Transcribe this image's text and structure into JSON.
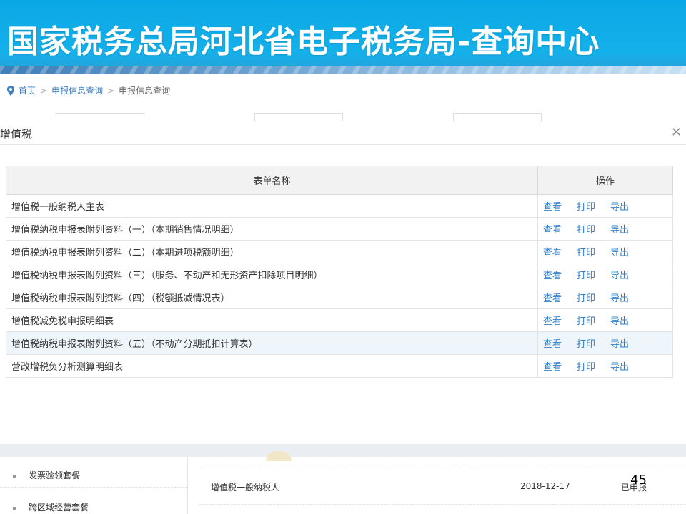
{
  "banner": {
    "title": "国家税务总局河北省电子税务局-查询中心"
  },
  "breadcrumb": {
    "home": "首页",
    "sep1": ">",
    "level1": "申报信息查询",
    "sep2": ">",
    "current": "申报信息查询"
  },
  "modal": {
    "title": "增值税",
    "close": "×",
    "table": {
      "col_name": "表单名称",
      "col_ops": "操作",
      "rows": [
        {
          "name": "增值税一般纳税人主表",
          "view": "查看",
          "print": "打印",
          "export": "导出"
        },
        {
          "name": "增值税纳税申报表附列资料（一）（本期销售情况明细）",
          "view": "查看",
          "print": "打印",
          "export": "导出"
        },
        {
          "name": "增值税纳税申报表附列资料（二）（本期进项税额明细）",
          "view": "查看",
          "print": "打印",
          "export": "导出"
        },
        {
          "name": "增值税纳税申报表附列资料（三）（服务、不动产和无形资产扣除项目明细）",
          "view": "查看",
          "print": "打印",
          "export": "导出"
        },
        {
          "name": "增值税纳税申报表附列资料（四）（税额抵减情况表）",
          "view": "查看",
          "print": "打印",
          "export": "导出"
        },
        {
          "name": "增值税减免税申报明细表",
          "view": "查看",
          "print": "打印",
          "export": "导出"
        },
        {
          "name": "增值税纳税申报表附列资料（五）（不动产分期抵扣计算表）",
          "view": "查看",
          "print": "打印",
          "export": "导出"
        },
        {
          "name": "营改增税负分析测算明细表",
          "view": "查看",
          "print": "打印",
          "export": "导出"
        }
      ]
    }
  },
  "left_menu": {
    "items": [
      "发票验领套餐",
      "跨区域经营套餐"
    ]
  },
  "record": {
    "type": "增值税一般纳税人",
    "date": "2018-12-17",
    "status": "已申报"
  },
  "slide": {
    "page_number": "45"
  },
  "colors": {
    "banner": "#14b0ea",
    "link": "#2f7fc7",
    "highlight_row": "#eef6fc"
  }
}
